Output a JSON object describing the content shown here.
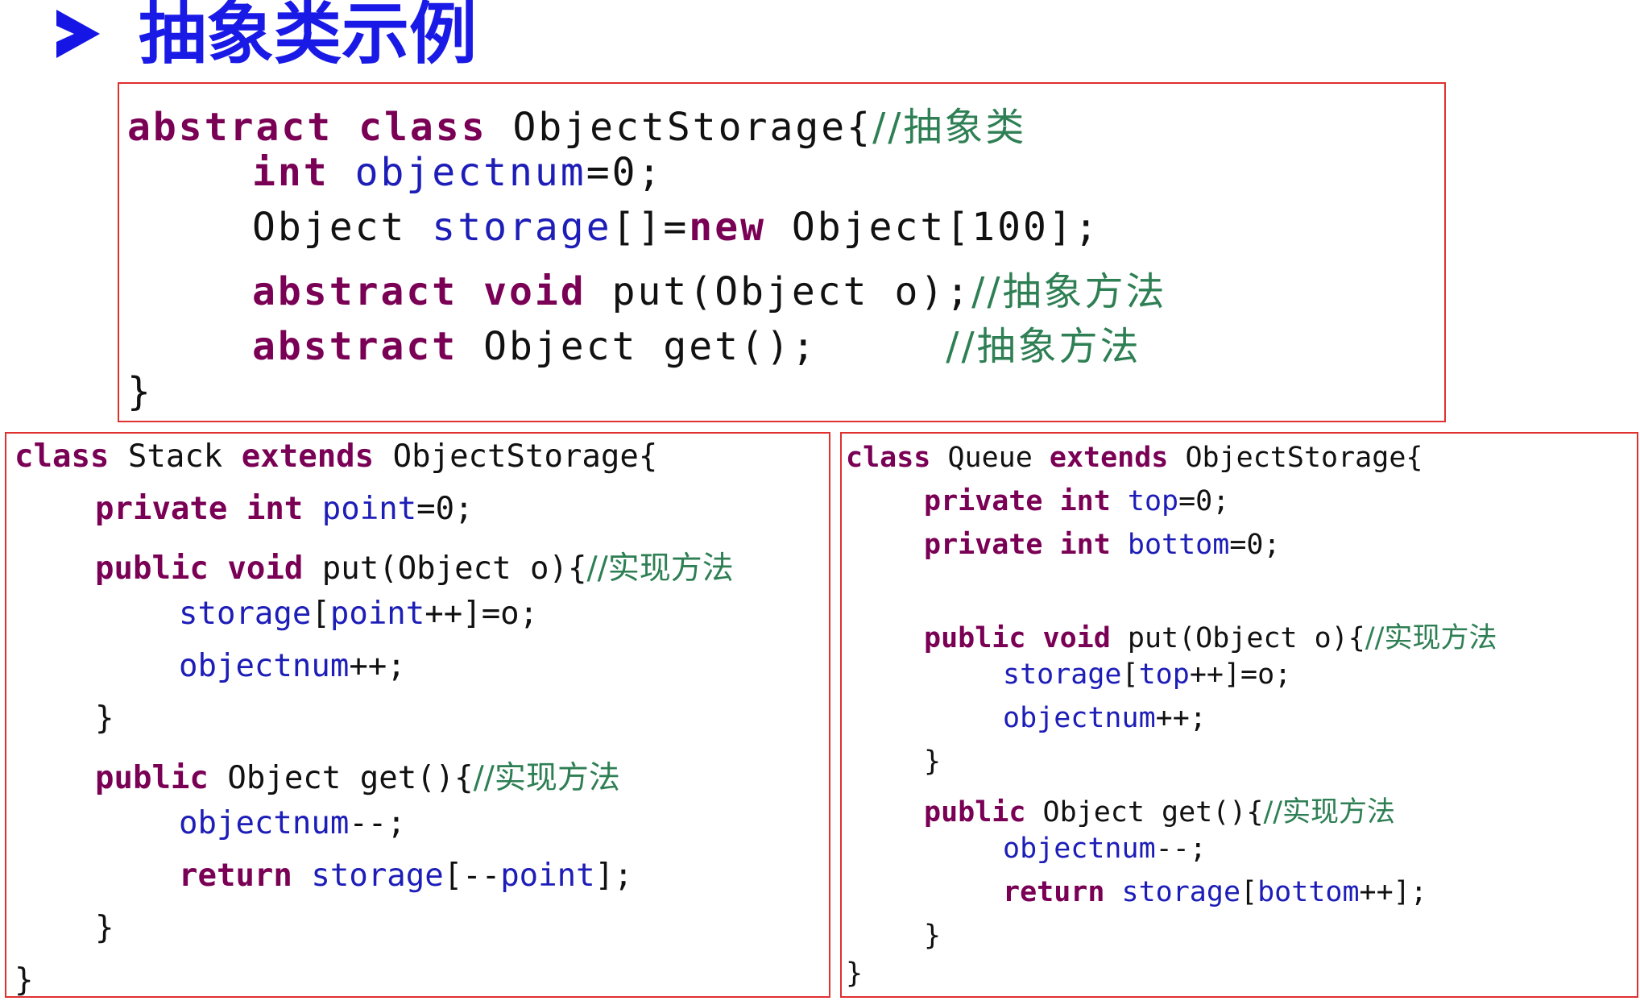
{
  "slide_title": "抽象类示例",
  "abstract_class": {
    "lines": [
      [
        [
          "kw",
          "abstract "
        ],
        [
          "kw",
          "class "
        ],
        [
          "pl",
          "ObjectStorage{"
        ],
        [
          "cm",
          "//抽象类"
        ]
      ],
      [
        [
          "kw",
          "int "
        ],
        [
          "fd",
          "objectnum"
        ],
        [
          "pl",
          "=0;"
        ]
      ],
      [
        [
          "pl",
          "Object "
        ],
        [
          "fd",
          "storage"
        ],
        [
          "pl",
          "[]="
        ],
        [
          "kw",
          "new "
        ],
        [
          "pl",
          "Object[100];"
        ]
      ],
      [
        [
          "kw",
          "abstract "
        ],
        [
          "kw",
          "void "
        ],
        [
          "pl",
          "put(Object o);"
        ],
        [
          "cm",
          "//抽象方法"
        ]
      ],
      [
        [
          "kw",
          "abstract "
        ],
        [
          "pl",
          "Object get();     "
        ],
        [
          "cm",
          "//抽象方法"
        ]
      ],
      [
        [
          "pl",
          "}"
        ]
      ]
    ]
  },
  "stack_class": {
    "lines": [
      [
        [
          "kw",
          "class "
        ],
        [
          "pl",
          "Stack "
        ],
        [
          "kw",
          "extends "
        ],
        [
          "pl",
          "ObjectStorage{"
        ]
      ],
      [
        [
          "kw",
          "private "
        ],
        [
          "kw",
          "int "
        ],
        [
          "fd",
          "point"
        ],
        [
          "pl",
          "=0;"
        ]
      ],
      [
        [
          "kw",
          "public "
        ],
        [
          "kw",
          "void "
        ],
        [
          "pl",
          "put(Object o){"
        ],
        [
          "cm",
          "//实现方法"
        ]
      ],
      [
        [
          "fd",
          "storage"
        ],
        [
          "pl",
          "["
        ],
        [
          "fd",
          "point"
        ],
        [
          "pl",
          "++]=o;"
        ]
      ],
      [
        [
          "fd",
          "objectnum"
        ],
        [
          "pl",
          "++;"
        ]
      ],
      [
        [
          "pl",
          "}"
        ]
      ],
      [
        [
          "kw",
          "public "
        ],
        [
          "pl",
          "Object get(){"
        ],
        [
          "cm",
          "//实现方法"
        ]
      ],
      [
        [
          "fd",
          "objectnum"
        ],
        [
          "pl",
          "--;"
        ]
      ],
      [
        [
          "kw",
          "return "
        ],
        [
          "fd",
          "storage"
        ],
        [
          "pl",
          "[--"
        ],
        [
          "fd",
          "point"
        ],
        [
          "pl",
          "];"
        ]
      ],
      [
        [
          "pl",
          "}"
        ]
      ],
      [
        [
          "pl",
          "}"
        ]
      ]
    ]
  },
  "queue_class": {
    "lines": [
      [
        [
          "kw",
          "class "
        ],
        [
          "pl",
          "Queue "
        ],
        [
          "kw",
          "extends "
        ],
        [
          "pl",
          "ObjectStorage{"
        ]
      ],
      [
        [
          "kw",
          "private "
        ],
        [
          "kw",
          "int "
        ],
        [
          "fd",
          "top"
        ],
        [
          "pl",
          "=0;"
        ]
      ],
      [
        [
          "kw",
          "private "
        ],
        [
          "kw",
          "int "
        ],
        [
          "fd",
          "bottom"
        ],
        [
          "pl",
          "=0;"
        ]
      ],
      [
        [
          "kw",
          "public "
        ],
        [
          "kw",
          "void "
        ],
        [
          "pl",
          "put(Object o){"
        ],
        [
          "cm",
          "//实现方法"
        ]
      ],
      [
        [
          "fd",
          "storage"
        ],
        [
          "pl",
          "["
        ],
        [
          "fd",
          "top"
        ],
        [
          "pl",
          "++]=o;"
        ]
      ],
      [
        [
          "fd",
          "objectnum"
        ],
        [
          "pl",
          "++;"
        ]
      ],
      [
        [
          "pl",
          "}"
        ]
      ],
      [
        [
          "kw",
          "public "
        ],
        [
          "pl",
          "Object get(){"
        ],
        [
          "cm",
          "//实现方法"
        ]
      ],
      [
        [
          "fd",
          "objectnum"
        ],
        [
          "pl",
          "--;"
        ]
      ],
      [
        [
          "kw",
          "return "
        ],
        [
          "fd",
          "storage"
        ],
        [
          "pl",
          "["
        ],
        [
          "fd",
          "bottom"
        ],
        [
          "pl",
          "++];"
        ]
      ],
      [
        [
          "pl",
          "}"
        ]
      ],
      [
        [
          "pl",
          "}"
        ]
      ]
    ]
  }
}
